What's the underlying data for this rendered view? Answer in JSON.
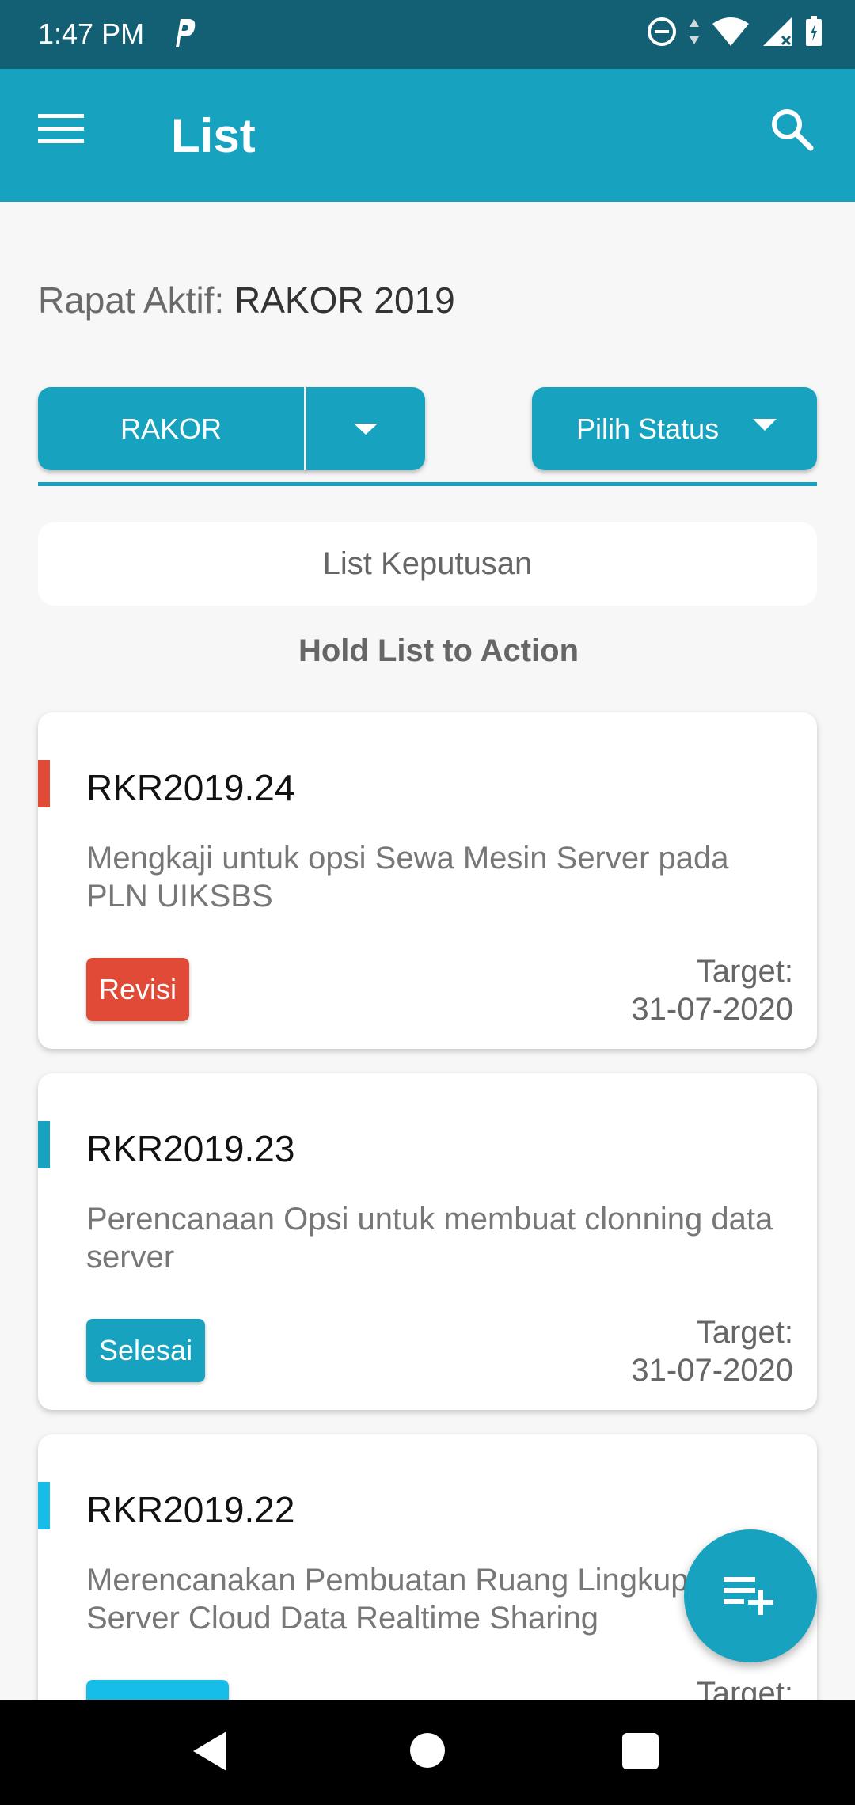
{
  "status_bar": {
    "time": "1:47 PM",
    "icons": [
      "parking-icon",
      "do-not-disturb-icon",
      "data-arrows-icon",
      "wifi-icon",
      "signal-icon",
      "battery-icon"
    ]
  },
  "app_bar": {
    "title": "List",
    "menu_icon": "hamburger-menu-icon",
    "search_icon": "search-icon"
  },
  "rapat": {
    "label": "Rapat Aktif:",
    "value": "RAKOR 2019"
  },
  "filters": {
    "type_selected": "RAKOR",
    "status_placeholder": "Pilih Status"
  },
  "list_keputusan": "List Keputusan",
  "hint": "Hold List to Action",
  "cards": [
    {
      "code": "RKR2019.24",
      "description": "Mengkaji untuk opsi Sewa Mesin Server pada PLN UIKSBS",
      "status": "Revisi",
      "status_color": "#e04a36",
      "target_label": "Target:",
      "target_date": "31-07-2020"
    },
    {
      "code": "RKR2019.23",
      "description": "Perencanaan Opsi untuk membuat clonning data server",
      "status": "Selesai",
      "status_color": "#17a2bf",
      "target_label": "Target:",
      "target_date": "31-07-2020"
    },
    {
      "code": "RKR2019.22",
      "description": "Merencanakan Pembuatan Ruang Lingkup Server Cloud Data Realtime Sharing",
      "status": "",
      "status_color": "#16bde6",
      "target_label": "Target:",
      "target_date": ""
    }
  ],
  "colors": {
    "primary": "#17a2bf",
    "status_bar": "#135f73",
    "revisi": "#e04a36",
    "selesai": "#17a2bf"
  },
  "fab_icon": "playlist-add-icon"
}
